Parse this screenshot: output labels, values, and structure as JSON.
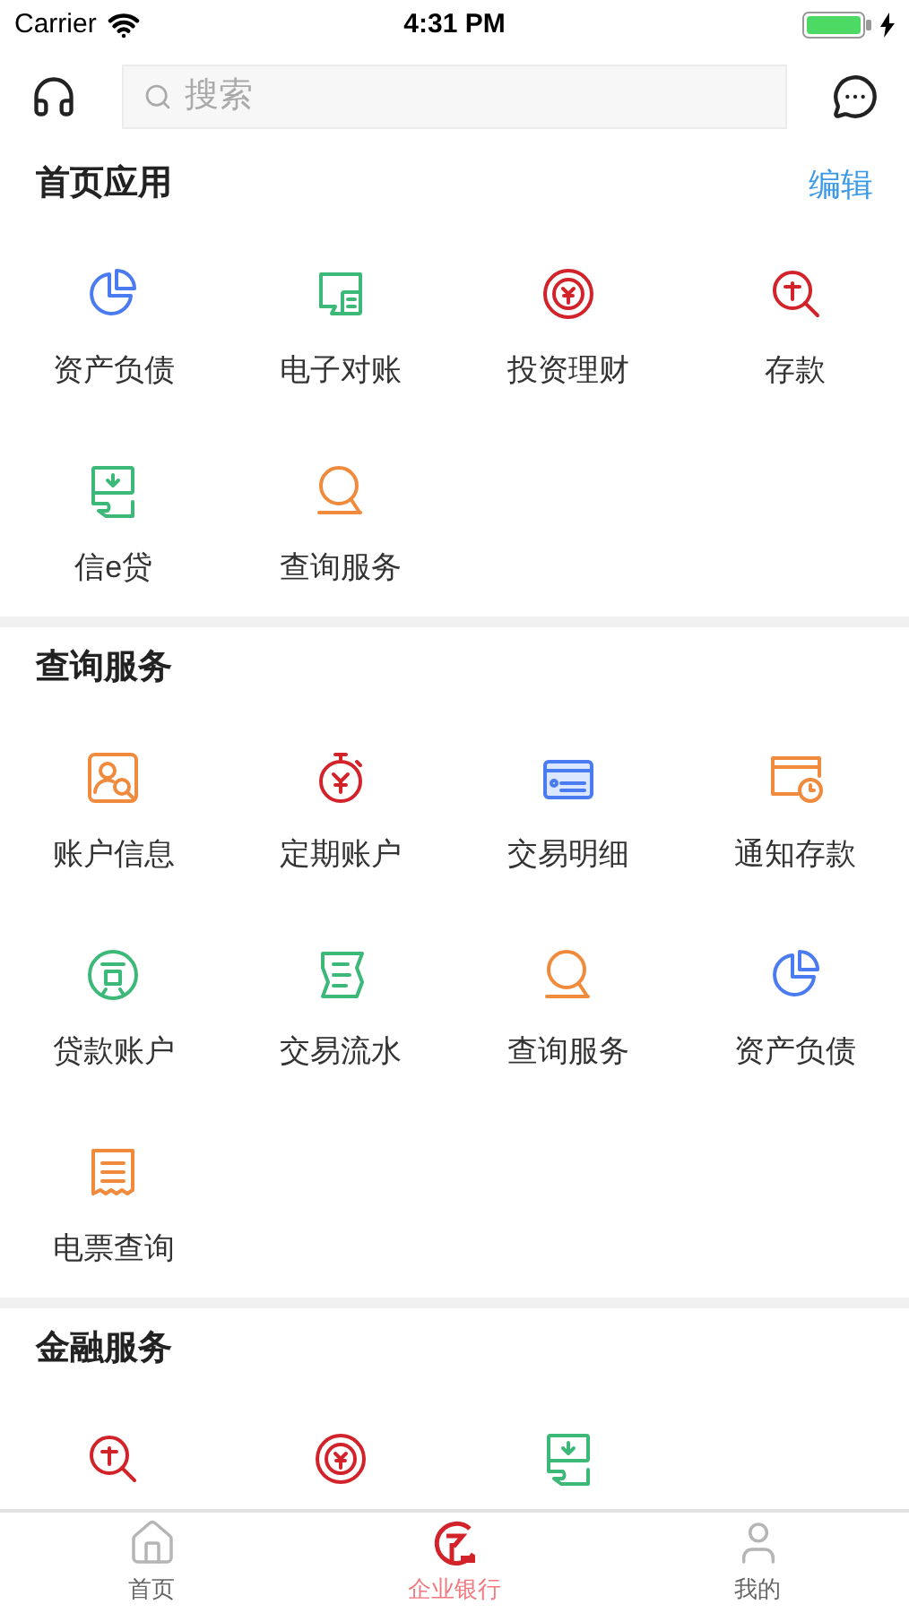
{
  "status_bar": {
    "carrier": "Carrier",
    "time": "4:31 PM"
  },
  "search": {
    "placeholder": "搜索"
  },
  "sections": [
    {
      "title": "首页应用",
      "action": "编辑",
      "items": [
        {
          "label": "资产负债",
          "kind": "pie"
        },
        {
          "label": "电子对账",
          "kind": "ledger"
        },
        {
          "label": "投资理财",
          "kind": "coin"
        },
        {
          "label": "存款",
          "kind": "deposit"
        },
        {
          "label": "信e贷",
          "kind": "bill"
        },
        {
          "label": "查询服务",
          "kind": "query"
        }
      ]
    },
    {
      "title": "查询服务",
      "items": [
        {
          "label": "账户信息",
          "kind": "account"
        },
        {
          "label": "定期账户",
          "kind": "timer"
        },
        {
          "label": "交易明细",
          "kind": "card"
        },
        {
          "label": "通知存款",
          "kind": "notice"
        },
        {
          "label": "贷款账户",
          "kind": "loan"
        },
        {
          "label": "交易流水",
          "kind": "flow"
        },
        {
          "label": "查询服务",
          "kind": "query"
        },
        {
          "label": "资产负债",
          "kind": "pie"
        },
        {
          "label": "电票查询",
          "kind": "receipt"
        }
      ]
    },
    {
      "title": "金融服务",
      "items": [
        {
          "kind": "deposit"
        },
        {
          "kind": "coin"
        },
        {
          "kind": "bill"
        }
      ]
    }
  ],
  "tab_bar": [
    {
      "label": "首页",
      "kind": "home",
      "selected": false
    },
    {
      "label": "企业银行",
      "kind": "bank",
      "selected": true
    },
    {
      "label": "我的",
      "kind": "user",
      "selected": false
    }
  ]
}
